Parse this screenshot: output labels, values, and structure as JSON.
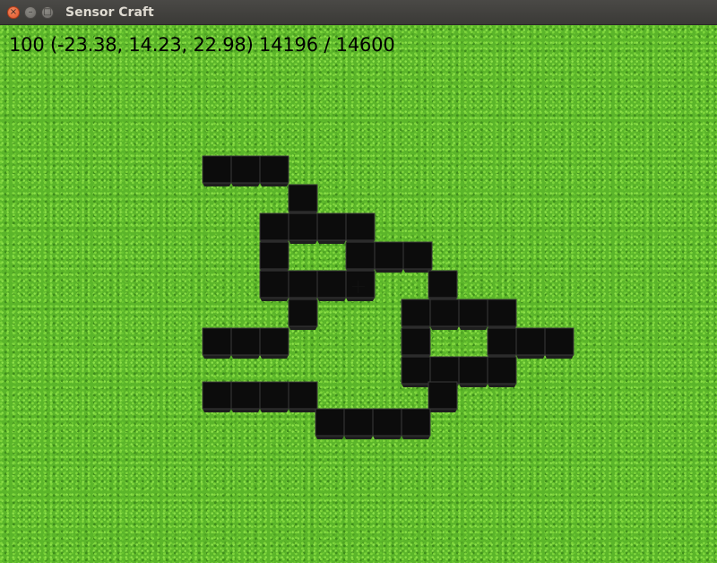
{
  "window": {
    "title": "Sensor Craft",
    "buttons": {
      "close": "×",
      "minimize": "–",
      "maximize": "□"
    }
  },
  "hud": {
    "text": "100 (-23.38, 14.23, 22.98) 14196 / 14600"
  },
  "colors": {
    "grass": "#5bb52a",
    "block_face": "#0c0c0c",
    "block_edge": "#3a3a3a",
    "block_side": "#1e1e1e",
    "hud_text": "#000000"
  },
  "world": {
    "ground_texture": "grass",
    "block_type": "black-stone",
    "block_count": 43
  }
}
